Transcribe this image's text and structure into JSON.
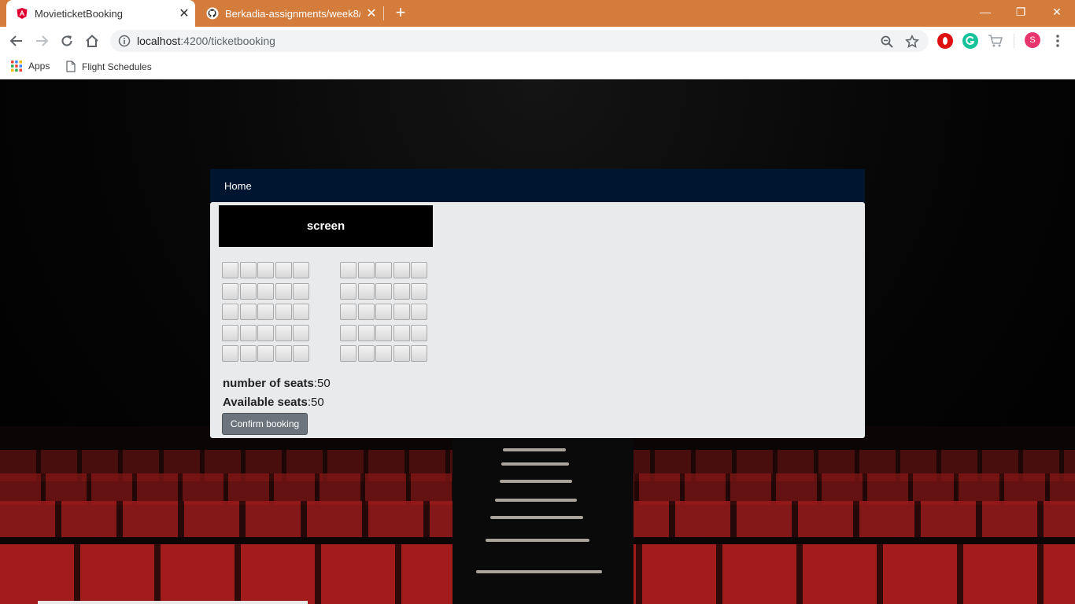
{
  "browser": {
    "tabs": [
      {
        "title": "MovieticketBooking",
        "active": true
      },
      {
        "title": "Berkadia-assignments/week8/tic",
        "active": false
      }
    ],
    "url_host": "localhost",
    "url_path": ":4200/ticketbooking",
    "bookmarks": [
      {
        "label": "Apps",
        "icon": "apps-grid-icon"
      },
      {
        "label": "Flight Schedules",
        "icon": "page-icon"
      }
    ],
    "profile_initial": "S"
  },
  "app": {
    "nav_home": "Home",
    "screen_label": "screen",
    "seat_blocks": [
      {
        "rows": 5,
        "cols": 5
      },
      {
        "rows": 5,
        "cols": 5
      }
    ],
    "stats": {
      "number_label": "number of seats",
      "number_value": ":50",
      "available_label": "Available seats",
      "available_value": ":50"
    },
    "confirm_label": "Confirm booking"
  },
  "colors": {
    "tabbar": "#d47c3c",
    "app_nav": "#001530",
    "card": "#e8eaec",
    "confirm_button": "#6c757d",
    "theatre_seat": "#7a1414"
  }
}
